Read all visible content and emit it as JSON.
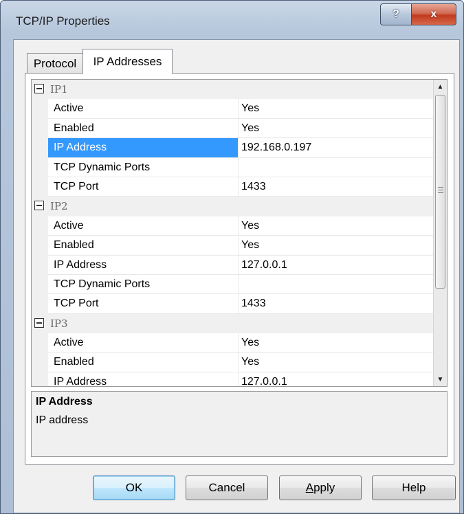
{
  "window": {
    "title": "TCP/IP Properties",
    "help_symbol": "?",
    "close_symbol": "x"
  },
  "tabs": [
    {
      "label": "Protocol",
      "active": false
    },
    {
      "label": "IP Addresses",
      "active": true
    }
  ],
  "grid": {
    "categories": [
      {
        "name": "IP1",
        "properties": [
          {
            "name": "Active",
            "value": "Yes"
          },
          {
            "name": "Enabled",
            "value": "Yes"
          },
          {
            "name": "IP Address",
            "value": "192.168.0.197",
            "selected": true
          },
          {
            "name": "TCP Dynamic Ports",
            "value": ""
          },
          {
            "name": "TCP Port",
            "value": "1433"
          }
        ]
      },
      {
        "name": "IP2",
        "properties": [
          {
            "name": "Active",
            "value": "Yes"
          },
          {
            "name": "Enabled",
            "value": "Yes"
          },
          {
            "name": "IP Address",
            "value": "127.0.0.1"
          },
          {
            "name": "TCP Dynamic Ports",
            "value": ""
          },
          {
            "name": "TCP Port",
            "value": "1433"
          }
        ]
      },
      {
        "name": "IP3",
        "properties": [
          {
            "name": "Active",
            "value": "Yes"
          },
          {
            "name": "Enabled",
            "value": "Yes"
          },
          {
            "name": "IP Address",
            "value": "127.0.0.1"
          }
        ]
      }
    ]
  },
  "description": {
    "title": "IP Address",
    "text": "IP address"
  },
  "buttons": {
    "ok": "OK",
    "cancel": "Cancel",
    "apply_accel": "A",
    "apply_rest": "pply",
    "help": "Help"
  },
  "colors": {
    "selection": "#3399ff",
    "category_bg": "#f0f0f0"
  }
}
